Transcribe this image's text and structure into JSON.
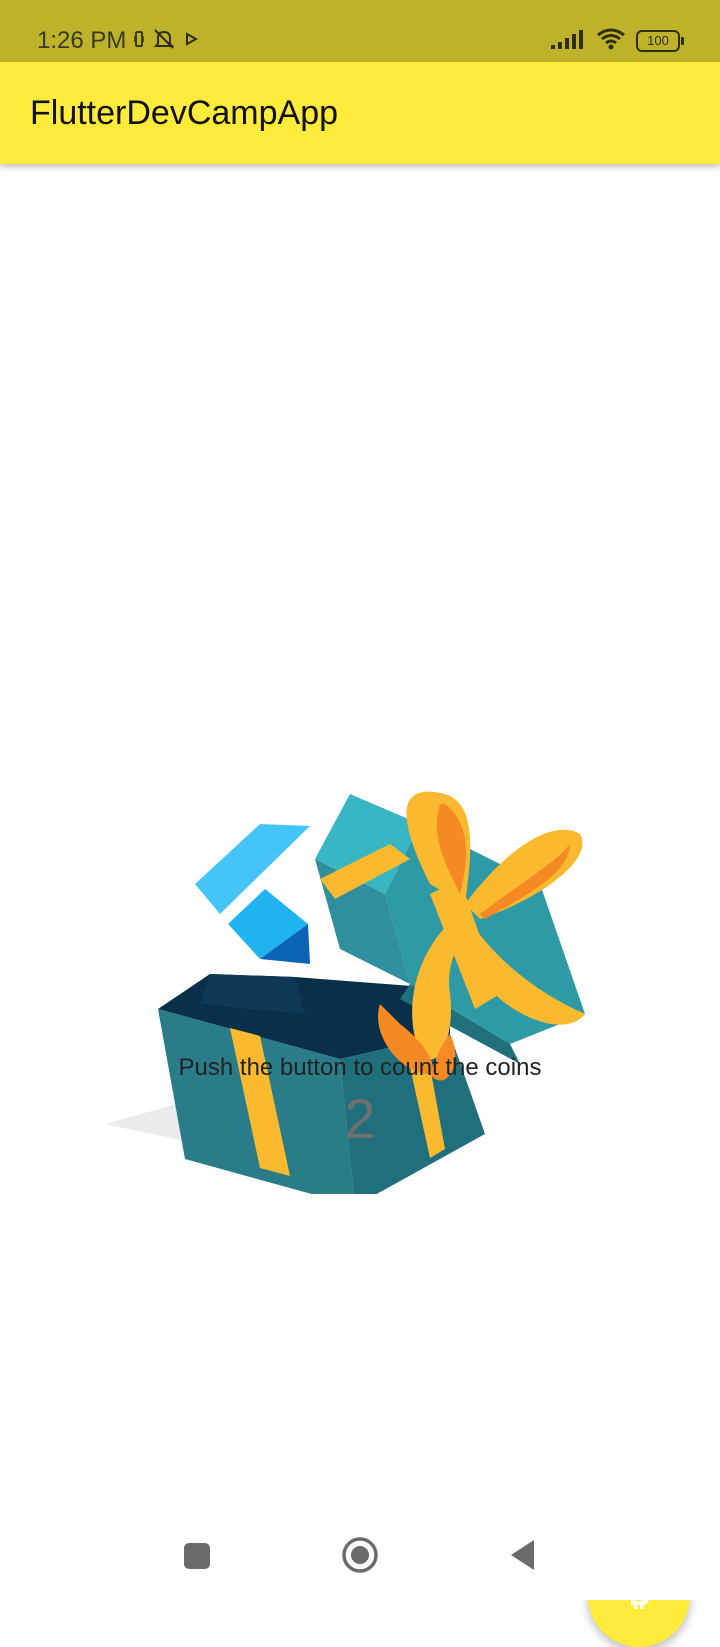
{
  "status_bar": {
    "time": "1:26 PM",
    "battery_level": "100",
    "icons": [
      "vibrate-icon",
      "alarm-off-icon",
      "play-icon",
      "signal-icon",
      "wifi-icon",
      "battery-icon"
    ]
  },
  "app_bar": {
    "title": "FlutterDevCampApp",
    "background_color": "#ffeb3b"
  },
  "main": {
    "illustration": "open-gift-box-with-flutter-logo",
    "message": "Push the button to count the coins",
    "counter_value": "2"
  },
  "fab": {
    "icon": "bitcoin-icon",
    "background_color": "#ffeb3b"
  },
  "nav_bar": {
    "buttons": [
      "recents-square",
      "home-circle",
      "back-triangle"
    ]
  }
}
